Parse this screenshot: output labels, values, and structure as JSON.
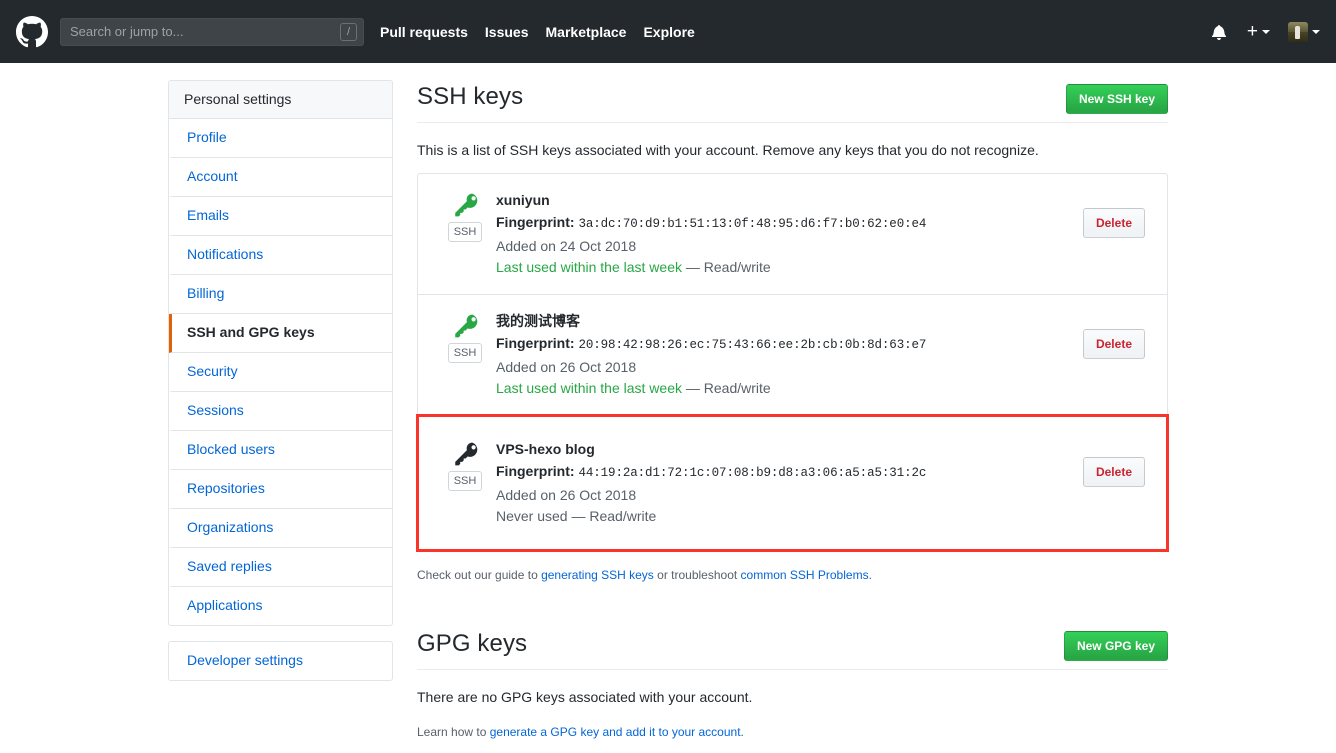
{
  "header": {
    "logo_icon": "github-mark-icon",
    "search": {
      "placeholder": "Search or jump to...",
      "value": "",
      "shortcut_badge": "/"
    },
    "nav": [
      {
        "label": "Pull requests"
      },
      {
        "label": "Issues"
      },
      {
        "label": "Marketplace"
      },
      {
        "label": "Explore"
      }
    ],
    "bell_icon": "notification-bell-icon",
    "plus_glyph": "+",
    "avatar_label": "user-avatar"
  },
  "sidebar": {
    "heading": "Personal settings",
    "items": [
      {
        "label": "Profile",
        "selected": false
      },
      {
        "label": "Account",
        "selected": false
      },
      {
        "label": "Emails",
        "selected": false
      },
      {
        "label": "Notifications",
        "selected": false
      },
      {
        "label": "Billing",
        "selected": false
      },
      {
        "label": "SSH and GPG keys",
        "selected": true
      },
      {
        "label": "Security",
        "selected": false
      },
      {
        "label": "Sessions",
        "selected": false
      },
      {
        "label": "Blocked users",
        "selected": false
      },
      {
        "label": "Repositories",
        "selected": false
      },
      {
        "label": "Organizations",
        "selected": false
      },
      {
        "label": "Saved replies",
        "selected": false
      },
      {
        "label": "Applications",
        "selected": false
      }
    ],
    "developer": {
      "label": "Developer settings"
    }
  },
  "ssh_section": {
    "title": "SSH keys",
    "new_key_button": "New SSH key",
    "description": "This is a list of SSH keys associated with your account. Remove any keys that you do not recognize.",
    "fingerprint_label": "Fingerprint:",
    "delete_button": "Delete",
    "badge": "SSH",
    "keys": [
      {
        "title": "xuniyun",
        "fingerprint": "3a:dc:70:d9:b1:51:13:0f:48:95:d6:f7:b0:62:e0:e4",
        "added": "Added on 24 Oct 2018",
        "usage_main": "Last used within the last week",
        "usage_rest": " — Read/write",
        "usage_state": "used",
        "icon_color": "#28a745",
        "highlighted": false
      },
      {
        "title": "我的测试博客",
        "fingerprint": "20:98:42:98:26:ec:75:43:66:ee:2b:cb:0b:8d:63:e7",
        "added": "Added on 26 Oct 2018",
        "usage_main": "Last used within the last week",
        "usage_rest": " — Read/write",
        "usage_state": "used",
        "icon_color": "#28a745",
        "highlighted": false
      },
      {
        "title": "VPS-hexo blog",
        "fingerprint": "44:19:2a:d1:72:1c:07:08:b9:d8:a3:06:a5:a5:31:2c",
        "added": "Added on 26 Oct 2018",
        "usage_main": "Never used",
        "usage_rest": " — Read/write",
        "usage_state": "never",
        "icon_color": "#24292e",
        "highlighted": true
      }
    ],
    "help_prefix": "Check out our guide to ",
    "help_link1": "generating SSH keys",
    "help_middle": " or troubleshoot ",
    "help_link2": "common SSH Problems",
    "help_suffix": "."
  },
  "gpg_section": {
    "title": "GPG keys",
    "new_key_button": "New GPG key",
    "empty_text": "There are no GPG keys associated with your account.",
    "learn_prefix": "Learn how to ",
    "learn_link": "generate a GPG key and add it to your account."
  },
  "colors": {
    "header_bg": "#24292e",
    "accent_green": "#28a745",
    "link_blue": "#0366d6",
    "danger_red": "#cb2431",
    "highlight_red": "#f9342a",
    "selected_orange": "#e36209",
    "muted_text": "#586069",
    "border": "#e1e4e8"
  }
}
